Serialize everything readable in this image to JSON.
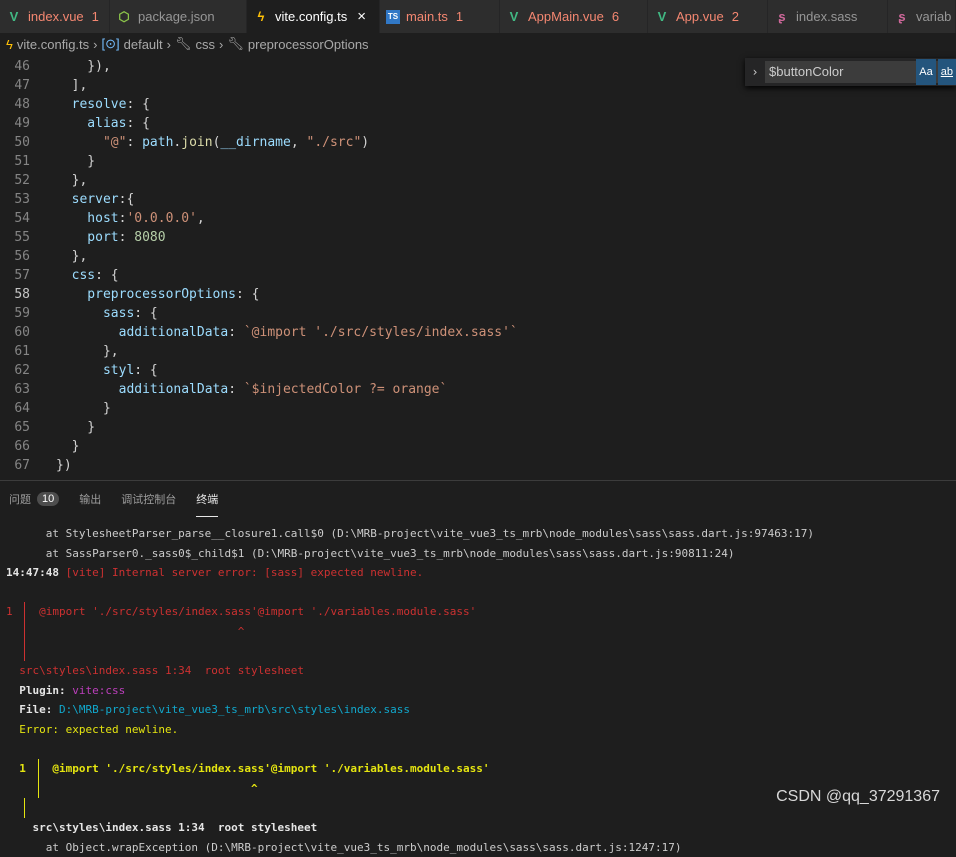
{
  "tabs": [
    {
      "label": "index.vue",
      "count": "1",
      "icon": "vue-icon",
      "color": "#f48771",
      "iconColor": "#41b883",
      "iconGlyph": "V"
    },
    {
      "label": "package.json",
      "count": "",
      "icon": "nodejs-icon",
      "color": "#969696",
      "iconColor": "#8bc34a",
      "iconGlyph": "⬡"
    },
    {
      "label": "vite.config.ts",
      "count": "",
      "icon": "vite-bolt-icon",
      "color": "#ffffff",
      "iconColor": "#ffc107",
      "iconGlyph": "ϟ",
      "active": true,
      "close": "×"
    },
    {
      "label": "main.ts",
      "count": "1",
      "icon": "typescript-icon",
      "color": "#f48771",
      "iconColor": "#3178c6",
      "iconGlyph": "TS"
    },
    {
      "label": "AppMain.vue",
      "count": "6",
      "icon": "vue-icon",
      "color": "#f48771",
      "iconColor": "#41b883",
      "iconGlyph": "V"
    },
    {
      "label": "App.vue",
      "count": "2",
      "icon": "vue-icon",
      "color": "#f48771",
      "iconColor": "#41b883",
      "iconGlyph": "V"
    },
    {
      "label": "index.sass",
      "count": "",
      "icon": "sass-icon",
      "color": "#969696",
      "iconColor": "#cd6799",
      "iconGlyph": "ʂ"
    },
    {
      "label": "variab",
      "count": "",
      "icon": "sass-icon",
      "color": "#969696",
      "iconColor": "#cd6799",
      "iconGlyph": "ʂ"
    }
  ],
  "breadcrumb": [
    "vite.config.ts",
    "default",
    "css",
    "preprocessorOptions"
  ],
  "find": {
    "value": "$buttonColor",
    "match_case": "Aa",
    "whole_word": "ab"
  },
  "code": [
    {
      "n": "46",
      "t": [
        [
          "    }),",
          "p"
        ]
      ]
    },
    {
      "n": "47",
      "t": [
        [
          "  ],",
          "p"
        ]
      ]
    },
    {
      "n": "48",
      "t": [
        [
          "  resolve",
          "k"
        ],
        [
          ": {",
          "p"
        ]
      ]
    },
    {
      "n": "49",
      "t": [
        [
          "    alias",
          "k"
        ],
        [
          ": {",
          "p"
        ]
      ]
    },
    {
      "n": "50",
      "t": [
        [
          "      \"@\"",
          "s"
        ],
        [
          ": ",
          "p"
        ],
        [
          "path",
          "k"
        ],
        [
          ".",
          "p"
        ],
        [
          "join",
          "f"
        ],
        [
          "(",
          "p"
        ],
        [
          "__dirname",
          "k"
        ],
        [
          ", ",
          "p"
        ],
        [
          "\"./src\"",
          "s"
        ],
        [
          ")",
          "p"
        ]
      ]
    },
    {
      "n": "51",
      "t": [
        [
          "    }",
          "p"
        ]
      ]
    },
    {
      "n": "52",
      "t": [
        [
          "  },",
          "p"
        ]
      ]
    },
    {
      "n": "53",
      "t": [
        [
          "  server",
          "k"
        ],
        [
          ":{",
          "p"
        ]
      ]
    },
    {
      "n": "54",
      "t": [
        [
          "    host",
          "k"
        ],
        [
          ":",
          "p"
        ],
        [
          "'0.0.0.0'",
          "s"
        ],
        [
          ",",
          "p"
        ]
      ]
    },
    {
      "n": "55",
      "t": [
        [
          "    port",
          "k"
        ],
        [
          ": ",
          "p"
        ],
        [
          "8080",
          "n"
        ]
      ]
    },
    {
      "n": "56",
      "t": [
        [
          "  },",
          "p"
        ]
      ]
    },
    {
      "n": "57",
      "t": [
        [
          "  css",
          "k"
        ],
        [
          ": {",
          "p"
        ]
      ]
    },
    {
      "n": "58",
      "t": [
        [
          "    preprocessorOptions",
          "k"
        ],
        [
          ": {",
          "p"
        ]
      ],
      "cur": true
    },
    {
      "n": "59",
      "t": [
        [
          "      sass",
          "k"
        ],
        [
          ": {",
          "p"
        ]
      ]
    },
    {
      "n": "60",
      "t": [
        [
          "        additionalData",
          "k"
        ],
        [
          ": ",
          "p"
        ],
        [
          "`@import './src/styles/index.sass'`",
          "s"
        ]
      ]
    },
    {
      "n": "61",
      "t": [
        [
          "      },",
          "p"
        ]
      ]
    },
    {
      "n": "62",
      "t": [
        [
          "      styl",
          "k"
        ],
        [
          ": {",
          "p"
        ]
      ]
    },
    {
      "n": "63",
      "t": [
        [
          "        additionalData",
          "k"
        ],
        [
          ": ",
          "p"
        ],
        [
          "`$injectedColor ?= orange`",
          "s"
        ]
      ]
    },
    {
      "n": "64",
      "t": [
        [
          "      }",
          "p"
        ]
      ]
    },
    {
      "n": "65",
      "t": [
        [
          "    }",
          "p"
        ]
      ]
    },
    {
      "n": "66",
      "t": [
        [
          "  }",
          "p"
        ]
      ]
    },
    {
      "n": "67",
      "t": [
        [
          "})",
          "p"
        ]
      ]
    }
  ],
  "panel": {
    "tabs": [
      "问题",
      "输出",
      "调试控制台",
      "终端"
    ],
    "problems_count": "10",
    "active": "终端"
  },
  "terminal": [
    {
      "t": [
        [
          "      at StylesheetParser_parse__closure1.call$0 (D:\\MRB-project\\vite_vue3_ts_mrb\\node_modules\\sass\\sass.dart.js:97463:17)",
          "w"
        ]
      ]
    },
    {
      "t": [
        [
          "      at SassParser0._sass0$_child$1 (D:\\MRB-project\\vite_vue3_ts_mrb\\node_modules\\sass\\sass.dart.js:90811:24)",
          "w"
        ]
      ]
    },
    {
      "t": [
        [
          "14:47:48 ",
          "b"
        ],
        [
          "[vite] Internal server error: [sass] expected newline.",
          "r"
        ]
      ]
    },
    {
      "t": [
        [
          "",
          "w"
        ]
      ]
    },
    {
      "t": [
        [
          "1  ",
          "r"
        ],
        [
          "  @import './src/styles/index.sass'@import './variables.module.sass'",
          "r"
        ]
      ],
      "bar": "#cd3131"
    },
    {
      "t": [
        [
          "                                   ^",
          "r"
        ]
      ],
      "bar": "#cd3131"
    },
    {
      "t": [
        [
          "",
          "w"
        ]
      ],
      "bar": "#cd3131"
    },
    {
      "t": [
        [
          "  src\\styles\\index.sass 1:34  root stylesheet",
          "r"
        ]
      ]
    },
    {
      "t": [
        [
          "  Plugin: ",
          "b"
        ],
        [
          "vite:css",
          "m"
        ]
      ]
    },
    {
      "t": [
        [
          "  File: ",
          "b"
        ],
        [
          "D:\\MRB-project\\vite_vue3_ts_mrb\\src\\styles\\index.sass",
          "c"
        ]
      ]
    },
    {
      "t": [
        [
          "  Error: expected newline.",
          "y"
        ]
      ]
    },
    {
      "t": [
        [
          "",
          "w"
        ]
      ]
    },
    {
      "t": [
        [
          "  1  ",
          "yb"
        ],
        [
          "  @import './src/styles/index.sass'@import './variables.module.sass'",
          "yb"
        ]
      ],
      "bar": "#e5e510"
    },
    {
      "t": [
        [
          "                                     ^",
          "yb"
        ]
      ],
      "bar": "#e5e510"
    },
    {
      "t": [
        [
          "",
          "w"
        ]
      ],
      "bar": "#e5e510"
    },
    {
      "t": [
        [
          "    src\\styles\\index.sass 1:34  root stylesheet",
          "b"
        ]
      ]
    },
    {
      "t": [
        [
          "      at Object.wrapException (D:\\MRB-project\\vite_vue3_ts_mrb\\node_modules\\sass\\sass.dart.js:1247:17)",
          "w"
        ]
      ]
    }
  ],
  "watermark": "CSDN @qq_37291367"
}
